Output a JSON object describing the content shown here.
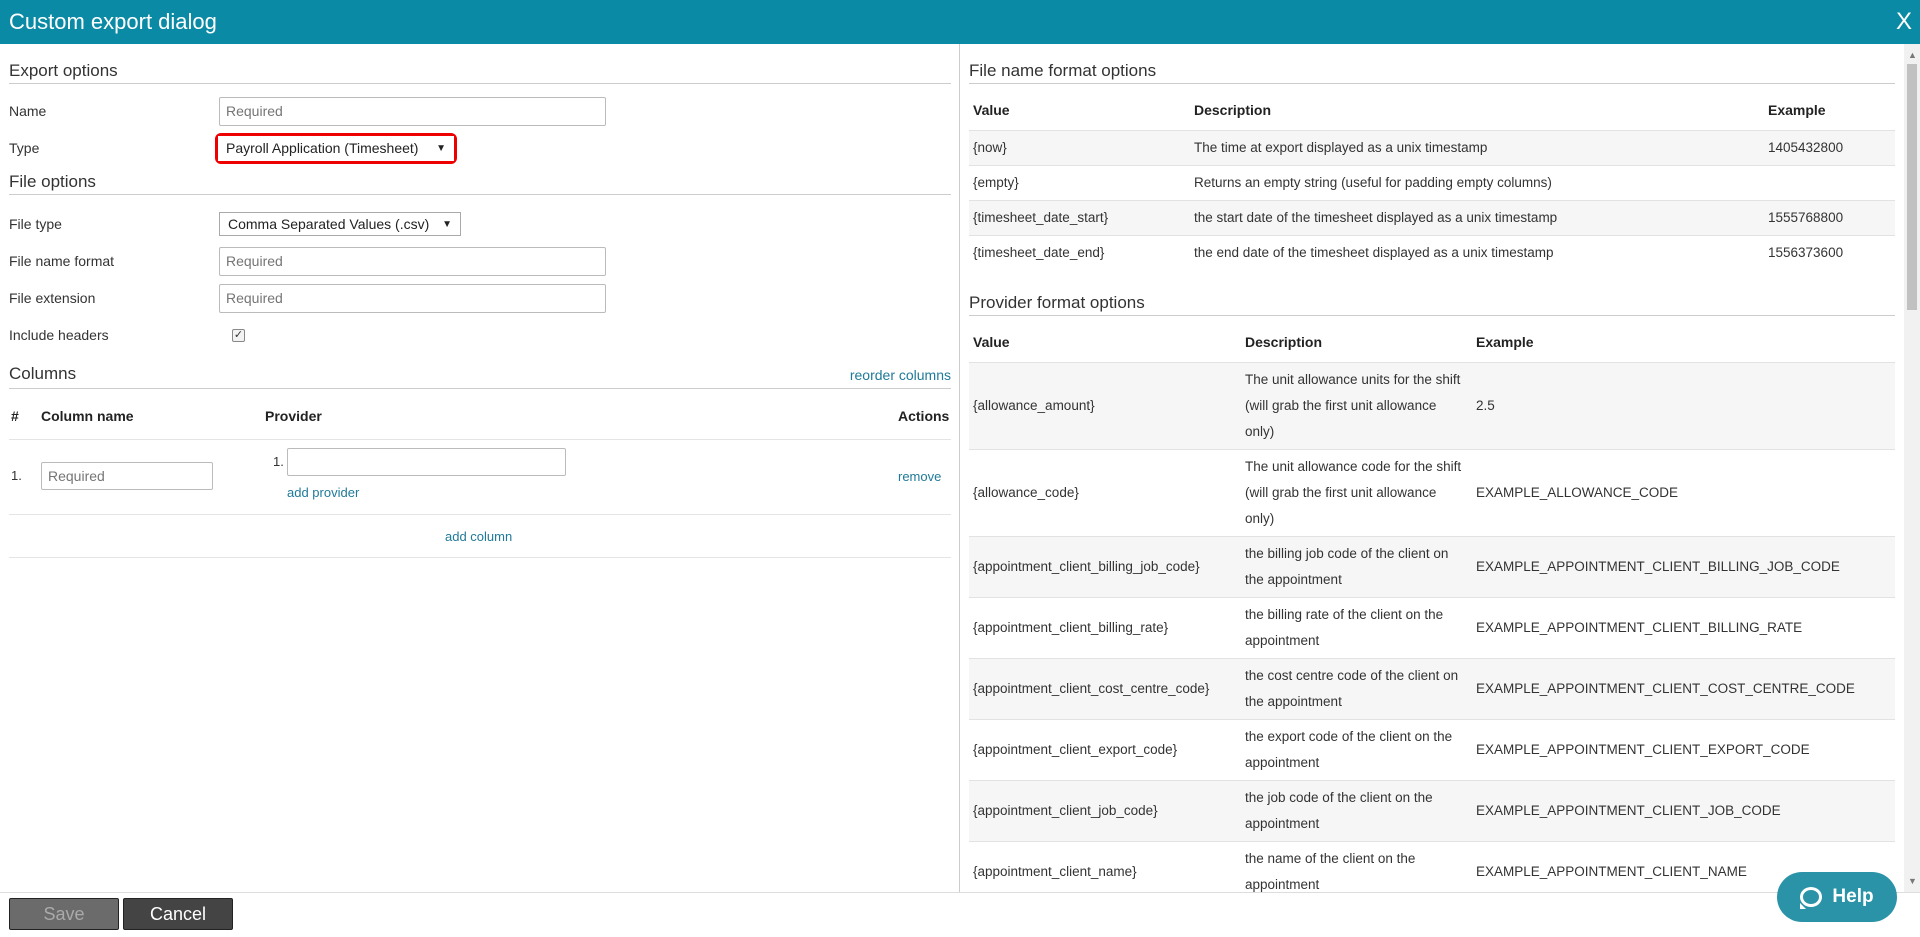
{
  "dialog": {
    "title": "Custom export dialog",
    "close_label": "X"
  },
  "export_options": {
    "heading": "Export options",
    "name_label": "Name",
    "name_placeholder": "Required",
    "type_label": "Type",
    "type_value": "Payroll Application (Timesheet)"
  },
  "file_options": {
    "heading": "File options",
    "file_type_label": "File type",
    "file_type_value": "Comma Separated Values (.csv)",
    "file_name_format_label": "File name format",
    "file_name_format_placeholder": "Required",
    "file_extension_label": "File extension",
    "file_extension_placeholder": "Required",
    "include_headers_label": "Include headers",
    "include_headers_checked": true
  },
  "columns": {
    "heading": "Columns",
    "reorder_link": "reorder columns",
    "headers": {
      "num": "#",
      "column_name": "Column name",
      "provider": "Provider",
      "actions": "Actions"
    },
    "rows": [
      {
        "num": "1.",
        "name_placeholder": "Required",
        "provider_num": "1.",
        "add_provider": "add provider",
        "remove": "remove"
      }
    ],
    "add_column": "add column"
  },
  "file_name_format_options": {
    "heading": "File name format options",
    "headers": {
      "value": "Value",
      "description": "Description",
      "example": "Example"
    },
    "rows": [
      {
        "value": "{now}",
        "description": "The time at export displayed as a unix timestamp",
        "example": "1405432800"
      },
      {
        "value": "{empty}",
        "description": "Returns an empty string (useful for padding empty columns)",
        "example": ""
      },
      {
        "value": "{timesheet_date_start}",
        "description": "the start date of the timesheet displayed as a unix timestamp",
        "example": "1555768800"
      },
      {
        "value": "{timesheet_date_end}",
        "description": "the end date of the timesheet displayed as a unix timestamp",
        "example": "1556373600"
      }
    ]
  },
  "provider_format_options": {
    "heading": "Provider format options",
    "headers": {
      "value": "Value",
      "description": "Description",
      "example": "Example"
    },
    "rows": [
      {
        "value": "{allowance_amount}",
        "description": "The unit allowance units for the shift (will grab the first unit allowance only)",
        "example": "2.5"
      },
      {
        "value": "{allowance_code}",
        "description": "The unit allowance code for the shift (will grab the first unit allowance only)",
        "example": "EXAMPLE_ALLOWANCE_CODE"
      },
      {
        "value": "{appointment_client_billing_job_code}",
        "description": "the billing job code of the client on the appointment",
        "example": "EXAMPLE_APPOINTMENT_CLIENT_BILLING_JOB_CODE"
      },
      {
        "value": "{appointment_client_billing_rate}",
        "description": "the billing rate of the client on the appointment",
        "example": "EXAMPLE_APPOINTMENT_CLIENT_BILLING_RATE"
      },
      {
        "value": "{appointment_client_cost_centre_code}",
        "description": "the cost centre code of the client on the appointment",
        "example": "EXAMPLE_APPOINTMENT_CLIENT_COST_CENTRE_CODE"
      },
      {
        "value": "{appointment_client_export_code}",
        "description": "the export code of the client on the appointment",
        "example": "EXAMPLE_APPOINTMENT_CLIENT_EXPORT_CODE"
      },
      {
        "value": "{appointment_client_job_code}",
        "description": "the job code of the client on the appointment",
        "example": "EXAMPLE_APPOINTMENT_CLIENT_JOB_CODE"
      },
      {
        "value": "{appointment_client_name}",
        "description": "the name of the client on the appointment",
        "example": "EXAMPLE_APPOINTMENT_CLIENT_NAME"
      }
    ]
  },
  "footer": {
    "save_label": "Save",
    "cancel_label": "Cancel"
  },
  "help": {
    "label": "Help"
  },
  "colors": {
    "titlebar": "#0b8aa5",
    "link": "#1f7a99",
    "highlight": "#e00000",
    "help": "#2a93a8"
  }
}
